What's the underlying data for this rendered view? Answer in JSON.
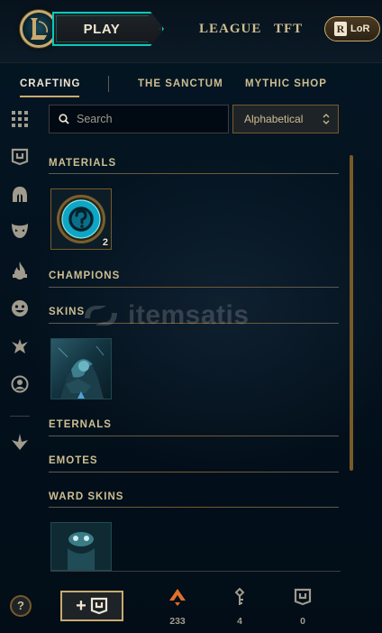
{
  "topbar": {
    "play_label": "PLAY",
    "nav": [
      "LEAGUE",
      "TFT"
    ],
    "lor_label": "LoR",
    "lor_badge": "R"
  },
  "subtabs": [
    {
      "label": "CRAFTING",
      "active": true
    },
    {
      "label": "THE SANCTUM",
      "active": false
    },
    {
      "label": "MYTHIC SHOP",
      "active": false
    }
  ],
  "sidebar": {
    "icons": [
      "grid-icon",
      "chest-icon",
      "champion-helmet-icon",
      "mask-icon",
      "flame-icon",
      "emote-face-icon",
      "ward-icon",
      "profile-icon",
      "arrow-down-icon"
    ]
  },
  "search": {
    "placeholder": "Search"
  },
  "sort": {
    "selected": "Alphabetical"
  },
  "sections": {
    "materials": {
      "title": "MATERIALS",
      "items": [
        {
          "name": "mystery-item",
          "count": "2"
        }
      ]
    },
    "champions": {
      "title": "CHAMPIONS"
    },
    "skins": {
      "title": "SKINS"
    },
    "eternals": {
      "title": "ETERNALS"
    },
    "emotes": {
      "title": "EMOTES"
    },
    "ward_skins": {
      "title": "WARD SKINS"
    }
  },
  "watermark": {
    "text": "itemsatis"
  },
  "bottom": {
    "help_label": "?",
    "craft_plus": "+",
    "currencies": [
      {
        "name": "orange-essence",
        "value": "233",
        "color": "#e0702a"
      },
      {
        "name": "keys",
        "value": "4",
        "color": "#a09b8c"
      },
      {
        "name": "chests",
        "value": "0",
        "color": "#a09b8c"
      }
    ]
  },
  "colors": {
    "gold": "#c8aa6e",
    "gold_text": "#cdbe91",
    "teal": "#0ac8b9",
    "background": "#010a13"
  }
}
